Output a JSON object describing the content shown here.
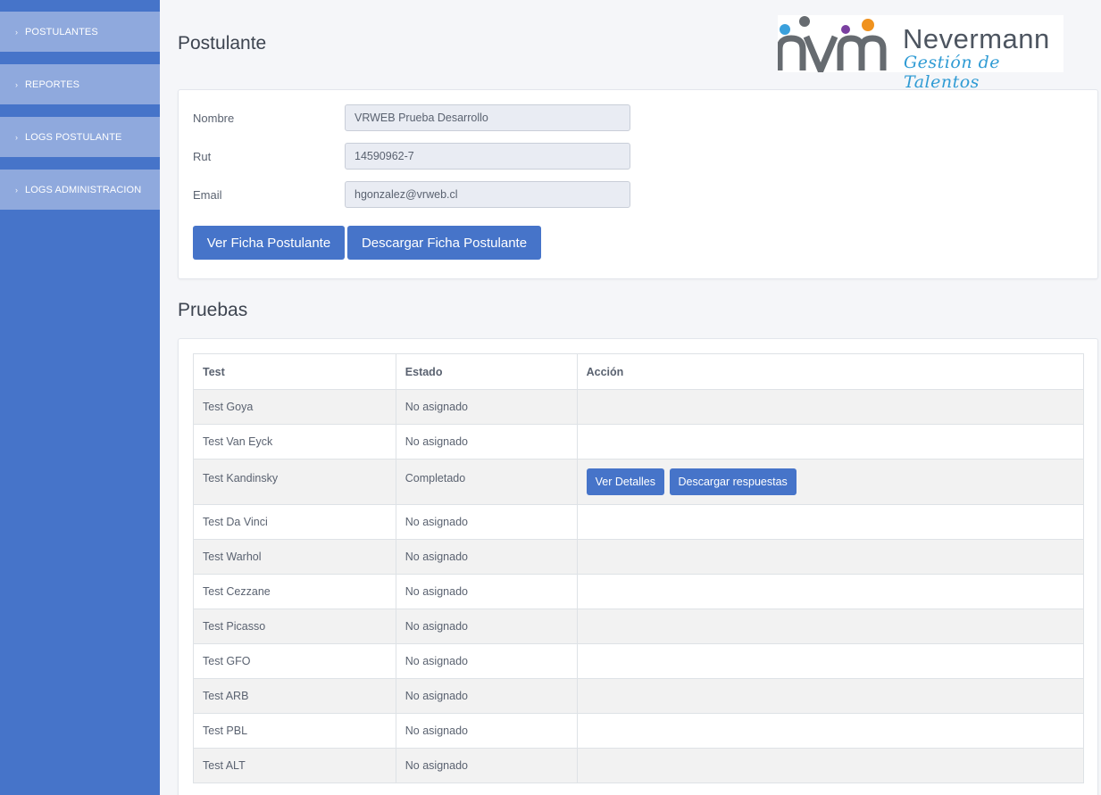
{
  "sidebar": {
    "items": [
      {
        "label": "POSTULANTES"
      },
      {
        "label": "REPORTES"
      },
      {
        "label": "LOGS POSTULANTE"
      },
      {
        "label": "LOGS ADMINISTRACION"
      }
    ],
    "chevron": "›"
  },
  "header": {
    "title": "Postulante",
    "logo": {
      "mark": "nvm",
      "brand": "Nevermann",
      "tagline": "Gestión de Talentos"
    }
  },
  "form": {
    "nombre_label": "Nombre",
    "nombre_value": "VRWEB Prueba Desarrollo",
    "rut_label": "Rut",
    "rut_value": "14590962-7",
    "email_label": "Email",
    "email_value": "hgonzalez@vrweb.cl",
    "ver_ficha_label": "Ver Ficha Postulante",
    "descargar_ficha_label": "Descargar Ficha Postulante"
  },
  "pruebas": {
    "title": "Pruebas",
    "columns": [
      "Test",
      "Estado",
      "Acción"
    ],
    "rows": [
      {
        "test": "Test Goya",
        "estado": "No asignado"
      },
      {
        "test": "Test Van Eyck",
        "estado": "No asignado"
      },
      {
        "test": "Test Kandinsky",
        "estado": "Completado",
        "actions": [
          "Ver Detalles",
          "Descargar respuestas"
        ]
      },
      {
        "test": "Test Da Vinci",
        "estado": "No asignado"
      },
      {
        "test": "Test Warhol",
        "estado": "No asignado"
      },
      {
        "test": "Test Cezzane",
        "estado": "No asignado"
      },
      {
        "test": "Test Picasso",
        "estado": "No asignado"
      },
      {
        "test": "Test GFO",
        "estado": "No asignado"
      },
      {
        "test": "Test ARB",
        "estado": "No asignado"
      },
      {
        "test": "Test PBL",
        "estado": "No asignado"
      },
      {
        "test": "Test ALT",
        "estado": "No asignado"
      }
    ]
  },
  "colors": {
    "sidebar_bg": "#4674c9",
    "sidebar_item_bg": "#8fa9dd",
    "primary": "#4674c9",
    "status_red": "#d9312b",
    "status_green": "#26b562",
    "logo_blue": "#3aa0dc",
    "logo_gray": "#666b70",
    "logo_purple": "#7a3fa0",
    "logo_orange": "#f0921e"
  },
  "icons": {
    "chevron": "chevron-right-icon",
    "logo": "nevermann-logo"
  }
}
